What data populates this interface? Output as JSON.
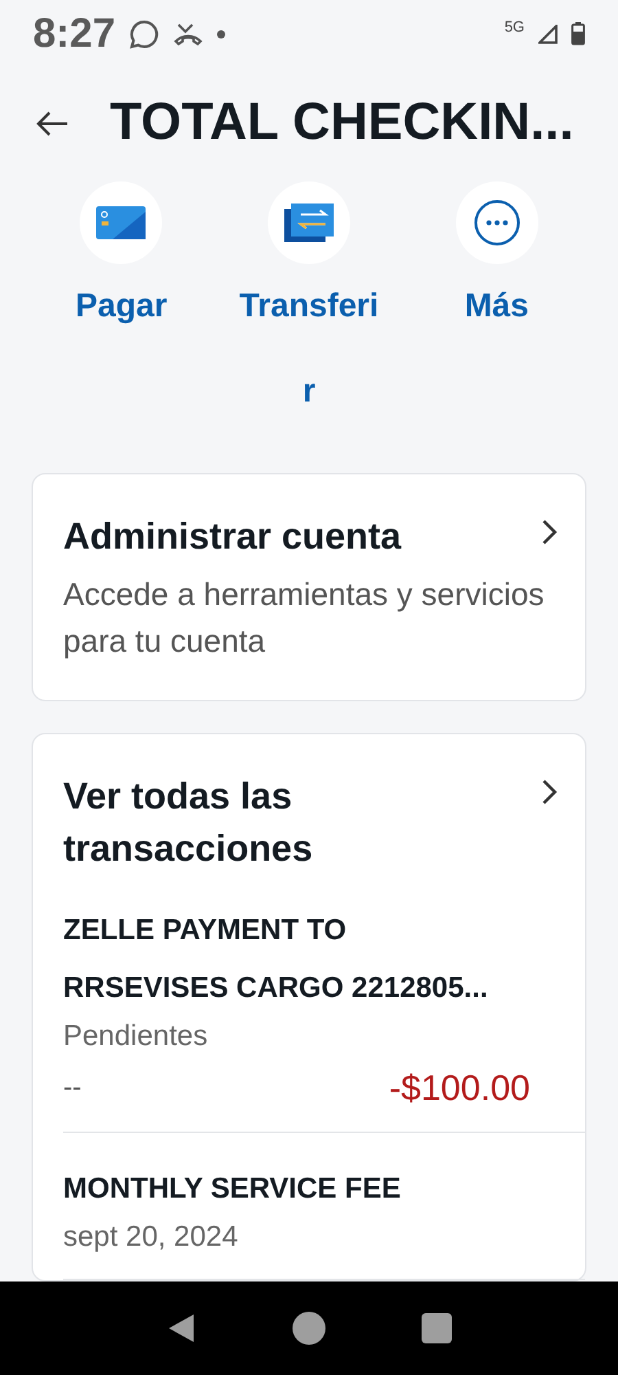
{
  "status_bar": {
    "time": "8:27",
    "network": "5G"
  },
  "header": {
    "title": "TOTAL CHECKIN..."
  },
  "actions": [
    {
      "kind": "card",
      "label": "Pagar"
    },
    {
      "kind": "transfer",
      "label": "Transferi\nr"
    },
    {
      "kind": "more",
      "label": "Más"
    }
  ],
  "manage_card": {
    "title": "Administrar cuenta",
    "description": "Accede a herramientas y servicios para tu cuenta"
  },
  "transactions_card": {
    "title": "Ver todas las transacciones",
    "transactions": [
      {
        "name_lines": [
          "ZELLE PAYMENT TO",
          "RRSEVISES CARGO 2212805..."
        ],
        "status": "Pendientes",
        "balance": "--",
        "amount": "-$100.00"
      },
      {
        "name_lines": [
          "MONTHLY SERVICE FEE"
        ],
        "status": "sept 20, 2024"
      }
    ]
  }
}
